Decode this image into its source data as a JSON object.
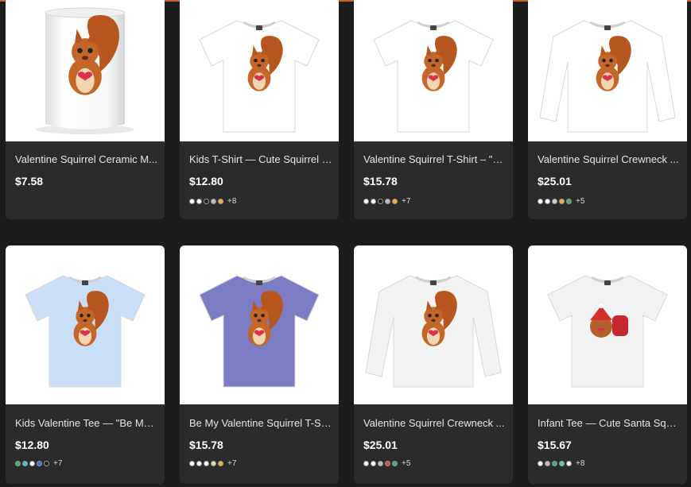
{
  "products": [
    {
      "title": "Valentine Squirrel Ceramic M...",
      "price": "$7.58",
      "image": "mug",
      "shirt_color": "#ffffff",
      "swatches": [],
      "more": ""
    },
    {
      "title": "Kids T-Shirt — Cute Squirrel V...",
      "price": "$12.80",
      "image": "tshirt",
      "shirt_color": "#ffffff",
      "swatches": [
        "#ffffff",
        "#ffffff",
        "#1a1a1a",
        "#bfbfbf",
        "#f2b233"
      ],
      "more": "+8"
    },
    {
      "title": "Valentine Squirrel T-Shirt – \"B...",
      "price": "$15.78",
      "image": "tshirt",
      "shirt_color": "#ffffff",
      "swatches": [
        "#ffffff",
        "#ffffff",
        "#1a1a1a",
        "#bfbfbf",
        "#f2b233"
      ],
      "more": "+7"
    },
    {
      "title": "Valentine Squirrel Crewneck ...",
      "price": "$25.01",
      "image": "sweatshirt",
      "shirt_color": "#ffffff",
      "swatches": [
        "#ffffff",
        "#ffffff",
        "#cfcfcf",
        "#f2b233",
        "#3cb371"
      ],
      "more": "+5"
    },
    {
      "title": "Kids Valentine Tee — \"Be My ...",
      "price": "$12.80",
      "image": "tshirt",
      "shirt_color": "#c9dff5",
      "swatches": [
        "#3cb371",
        "#40c8d8",
        "#ffffff",
        "#3b6fd6",
        "#1a1a1a"
      ],
      "more": "+7"
    },
    {
      "title": "Be My Valentine Squirrel T-Sh...",
      "price": "$15.78",
      "image": "tshirt",
      "shirt_color": "#7b7cc4",
      "swatches": [
        "#ffffff",
        "#ffffff",
        "#ffffff",
        "#f0d9a8",
        "#f2b233"
      ],
      "more": "+7"
    },
    {
      "title": "Valentine Squirrel Crewneck ...",
      "price": "$25.01",
      "image": "sweatshirt",
      "shirt_color": "#f3f3f3",
      "swatches": [
        "#ffffff",
        "#ffffff",
        "#bfbfbf",
        "#e04848",
        "#3cb371"
      ],
      "more": "+5"
    },
    {
      "title": "Infant Tee — Cute Santa Squi...",
      "price": "$15.67",
      "image": "tshirt-santa",
      "shirt_color": "#f2f2f2",
      "swatches": [
        "#ffffff",
        "#bfbfbf",
        "#3cb371",
        "#5cc8b8",
        "#ffffff"
      ],
      "more": "+8"
    }
  ]
}
